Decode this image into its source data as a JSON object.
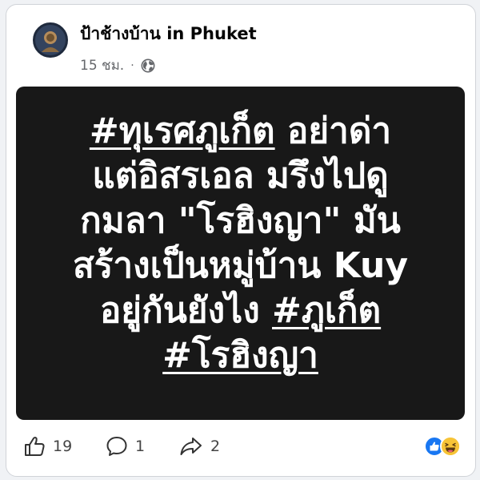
{
  "post": {
    "page_name": "ป้าช้างบ้าน in Phuket",
    "timestamp": "15 ชม.",
    "separator": "·",
    "audience_icon": "globe-icon",
    "text_lines": [
      {
        "hashtag": "#ทุเรศภูเก็ต",
        "text": " อย่าด่า"
      },
      {
        "text": "แต่อิสรเอล มรึงไปดู"
      },
      {
        "text": "กมลา \"โรฮิงญา\" มัน"
      },
      {
        "text": "สร้างเป็นหมู่บ้าน Kuy"
      },
      {
        "text": "อยู่กันยังไง ",
        "hashtag_suffix": "#ภูเก็ต"
      },
      {
        "hashtag": "#โรฮิงญา"
      }
    ],
    "background_color": "#181818",
    "text_color": "#ffffff"
  },
  "actions": {
    "like_count": "19",
    "comment_count": "1",
    "share_count": "2",
    "like_icon": "thumbs-up-icon",
    "comment_icon": "comment-bubble-icon",
    "share_icon": "share-arrow-icon"
  },
  "reactions": {
    "types": [
      "like",
      "haha"
    ],
    "colors": {
      "like": "#1877f2",
      "haha": "#f7c437"
    }
  }
}
